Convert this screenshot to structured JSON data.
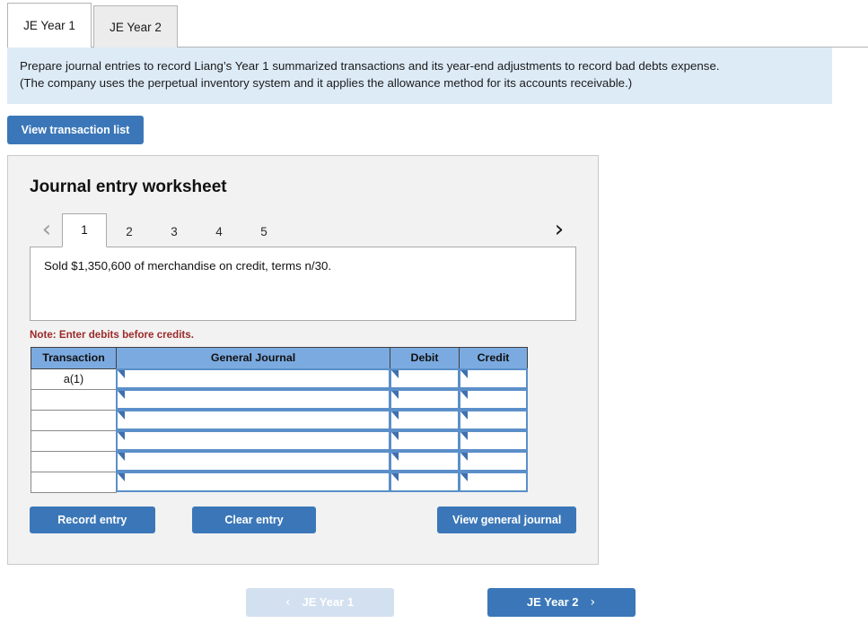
{
  "tabs": [
    {
      "label": "JE Year 1",
      "active": true
    },
    {
      "label": "JE Year 2",
      "active": false
    }
  ],
  "banner": {
    "line1": "Prepare journal entries to record Liang’s Year 1 summarized transactions and its year-end adjustments to record bad debts expense.",
    "line2": "(The company uses the perpetual inventory system and it applies the allowance method for its accounts receivable.)",
    "background": "#ddebf7"
  },
  "toolbar": {
    "view_transaction_list": "View transaction list"
  },
  "worksheet": {
    "title": "Journal entry worksheet",
    "pager": {
      "prev_icon": "‹",
      "next_icon": "›",
      "pages": [
        "1",
        "2",
        "3",
        "4",
        "5"
      ],
      "current": "1"
    },
    "description": "Sold $1,350,600 of merchandise on credit, terms n/30.",
    "note": "Note: Enter debits before credits.",
    "note_color": "#9c2a2a",
    "table": {
      "headers": [
        "Transaction",
        "General Journal",
        "Debit",
        "Credit"
      ],
      "header_background": "#7baae0",
      "rows": [
        {
          "transaction": "a(1)",
          "general_journal": "",
          "debit": "",
          "credit": ""
        },
        {
          "transaction": "",
          "general_journal": "",
          "debit": "",
          "credit": ""
        },
        {
          "transaction": "",
          "general_journal": "",
          "debit": "",
          "credit": ""
        },
        {
          "transaction": "",
          "general_journal": "",
          "debit": "",
          "credit": ""
        },
        {
          "transaction": "",
          "general_journal": "",
          "debit": "",
          "credit": ""
        },
        {
          "transaction": "",
          "general_journal": "",
          "debit": "",
          "credit": ""
        }
      ]
    },
    "actions": {
      "record_entry": "Record entry",
      "clear_entry": "Clear entry",
      "view_general_journal": "View general journal"
    }
  },
  "bottom_nav": {
    "prev": {
      "label": "JE Year 1",
      "icon": "‹",
      "enabled": false,
      "background": "#d3e0f0"
    },
    "next": {
      "label": "JE Year 2",
      "icon": "›",
      "enabled": true,
      "background": "#3b77b8"
    }
  },
  "colors": {
    "accent_blue": "#3b77b8",
    "panel_background": "#f2f2f2",
    "input_border": "#5b8fc9"
  }
}
